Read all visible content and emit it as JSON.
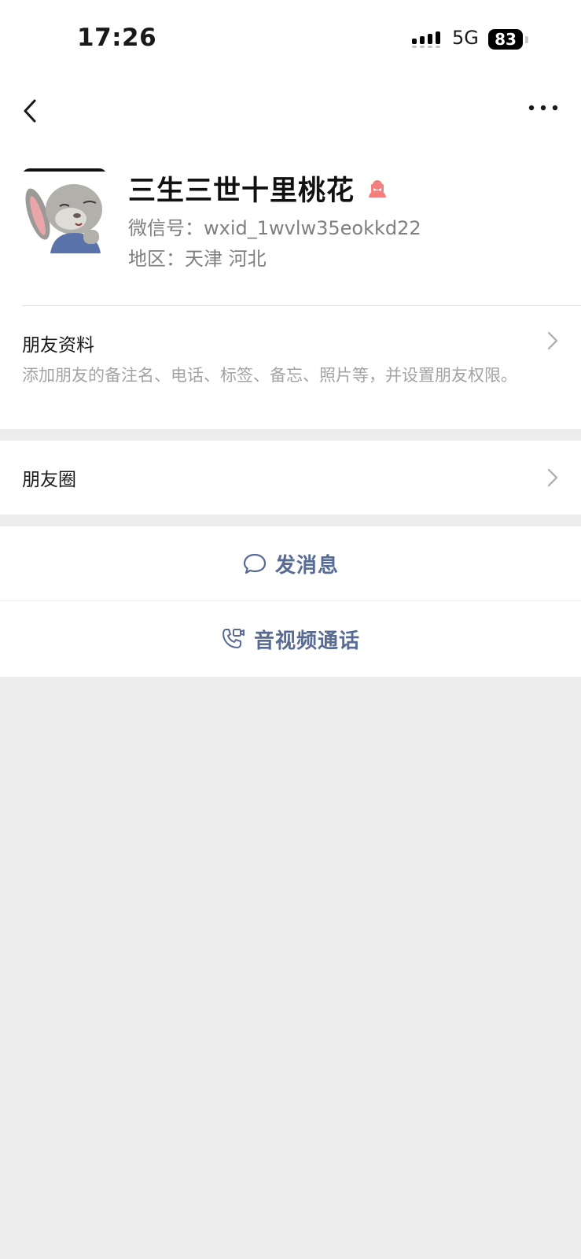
{
  "status_bar": {
    "time": "17:26",
    "network": "5G",
    "battery": "83",
    "icons": [
      "signal-icon",
      "battery-icon"
    ]
  },
  "nav": {
    "icons": [
      "back-icon",
      "more-icon"
    ]
  },
  "profile": {
    "name": "三生三世十里桃花",
    "wechat_id": "微信号：wxid_1wvlw35eokkd22",
    "region": "地区：天津  河北",
    "gender_icon": "female-icon",
    "gender_color": "#f37e7d"
  },
  "friend_info": {
    "title": "朋友资料",
    "description": "添加朋友的备注名、电话、标签、备忘、照片等，并设置朋友权限。"
  },
  "moments": {
    "title": "朋友圈"
  },
  "actions": {
    "message_label": "发消息",
    "call_label": "音视频通话",
    "link_color": "#576b95"
  }
}
